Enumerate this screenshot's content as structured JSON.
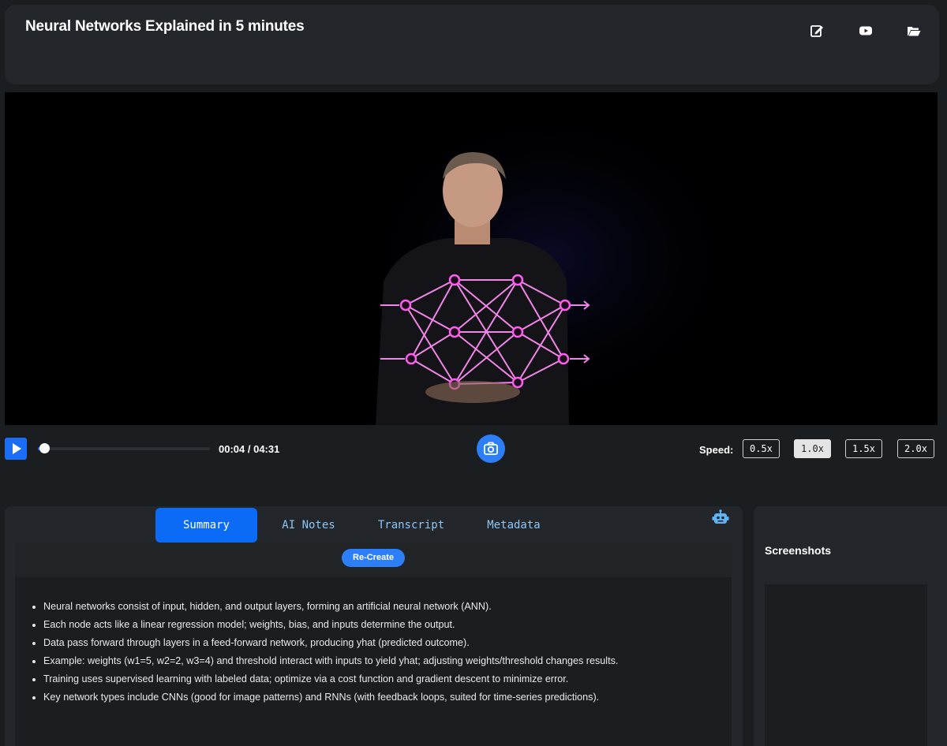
{
  "header": {
    "title": "Neural Networks Explained in 5 minutes",
    "icons": [
      "edit-icon",
      "youtube-icon",
      "folder-open-icon"
    ]
  },
  "player": {
    "current_time": "00:04",
    "duration": "04:31",
    "time_display": "00:04 / 04:31",
    "progress_fraction": 0.015,
    "speed_label": "Speed:",
    "speeds": [
      "0.5x",
      "1.0x",
      "1.5x",
      "2.0x"
    ],
    "selected_speed": "1.0x",
    "accent_color": "#1a6ef5"
  },
  "tabs": [
    {
      "label": "Summary",
      "active": true
    },
    {
      "label": "AI Notes",
      "active": false
    },
    {
      "label": "Transcript",
      "active": false
    },
    {
      "label": "Metadata",
      "active": false
    }
  ],
  "summary": {
    "recreate_label": "Re-Create",
    "items": [
      "Neural networks consist of input, hidden, and output layers, forming an artificial neural network (ANN).",
      "Each node acts like a linear regression model; weights, bias, and inputs determine the output.",
      "Data pass forward through layers in a feed-forward network, producing yhat (predicted outcome).",
      "Example: weights (w1=5, w2=2, w3=4) and threshold interact with inputs to yield yhat; adjusting weights/threshold changes results.",
      "Training uses supervised learning with labeled data; optimize via a cost function and gradient descent to minimize error.",
      "Key network types include CNNs (good for image patterns) and RNNs (with feedback loops, suited for time-series predictions)."
    ]
  },
  "screenshots": {
    "title": "Screenshots"
  }
}
